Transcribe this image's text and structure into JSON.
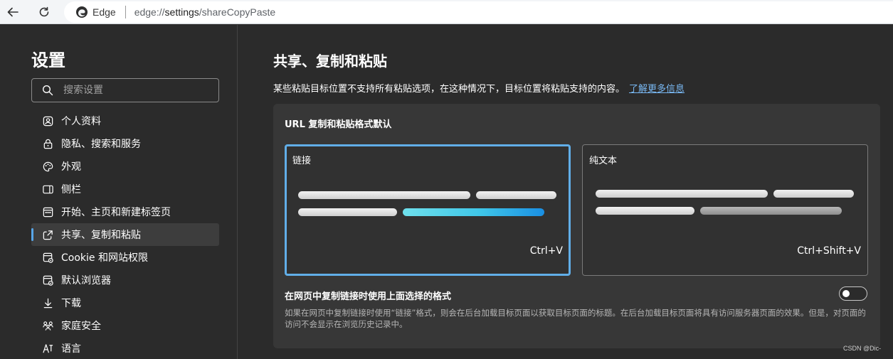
{
  "browser": {
    "site_name": "Edge",
    "url_prefix": "edge://",
    "url_host": "settings",
    "url_path": "/shareCopyPaste"
  },
  "sidebar": {
    "title": "设置",
    "search_placeholder": "搜索设置",
    "items": [
      {
        "label": "个人资料",
        "icon": "profile-icon"
      },
      {
        "label": "隐私、搜索和服务",
        "icon": "lock-icon"
      },
      {
        "label": "外观",
        "icon": "palette-icon"
      },
      {
        "label": "侧栏",
        "icon": "sidebar-panel-icon"
      },
      {
        "label": "开始、主页和新建标签页",
        "icon": "home-grid-icon"
      },
      {
        "label": "共享、复制和粘贴",
        "icon": "share-icon",
        "active": true
      },
      {
        "label": "Cookie 和网站权限",
        "icon": "site-permissions-icon"
      },
      {
        "label": "默认浏览器",
        "icon": "browser-icon"
      },
      {
        "label": "下载",
        "icon": "download-icon"
      },
      {
        "label": "家庭安全",
        "icon": "family-icon"
      },
      {
        "label": "语言",
        "icon": "language-icon"
      }
    ]
  },
  "main": {
    "title": "共享、复制和粘贴",
    "description": "某些粘贴目标位置不支持所有粘贴选项，在这种情况下，目标位置将粘贴支持的内容。",
    "learn_more": "了解更多信息",
    "card": {
      "title": "URL 复制和粘贴格式默认",
      "options": [
        {
          "label": "链接",
          "shortcut": "Ctrl+V",
          "selected": true
        },
        {
          "label": "纯文本",
          "shortcut": "Ctrl+Shift+V",
          "selected": false
        }
      ],
      "toggle_label": "在网页中复制链接时使用上面选择的格式",
      "toggle_on": false,
      "toggle_description": "如果在网页中复制链接时使用“链接”格式，则会在后台加载目标页面以获取目标页面的标题。在后台加载目标页面将具有访问服务器页面的效果。但是，对页面的访问不会显示在浏览历史记录中。"
    }
  },
  "colors": {
    "accent": "#61aee8",
    "link": "#79b8f3",
    "background": "#2b2b2b",
    "card": "#373737"
  },
  "watermark": "CSDN @Dic-"
}
